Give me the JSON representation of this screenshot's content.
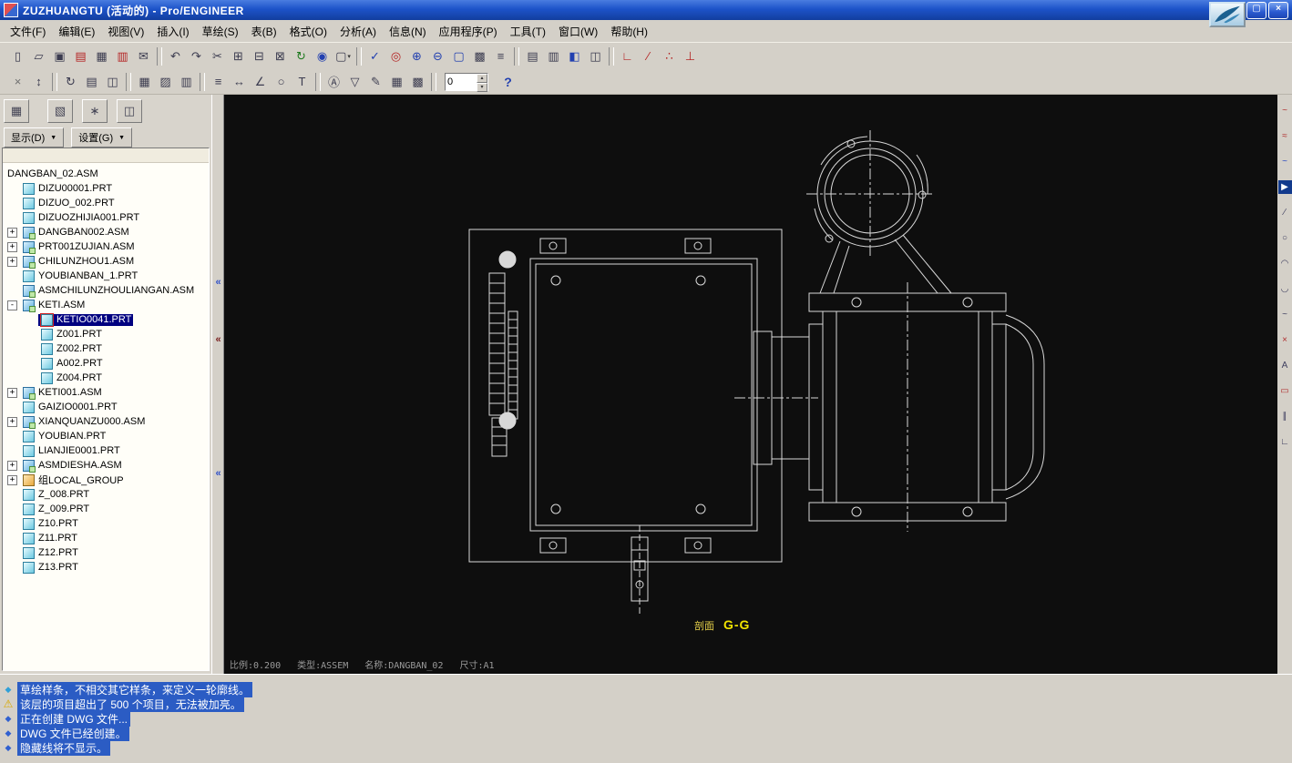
{
  "window": {
    "title": "ZUZHUANGTU (活动的) - Pro/ENGINEER",
    "buttons": [
      {
        "name": "minimize-button",
        "glyph": "_"
      },
      {
        "name": "maximize-button",
        "glyph": "▢"
      },
      {
        "name": "close-button",
        "glyph": "×"
      }
    ]
  },
  "menu": {
    "items": [
      {
        "label": "文件(F)"
      },
      {
        "label": "编辑(E)"
      },
      {
        "label": "视图(V)"
      },
      {
        "label": "插入(I)"
      },
      {
        "label": "草绘(S)"
      },
      {
        "label": "表(B)"
      },
      {
        "label": "格式(O)"
      },
      {
        "label": "分析(A)"
      },
      {
        "label": "信息(N)"
      },
      {
        "label": "应用程序(P)"
      },
      {
        "label": "工具(T)"
      },
      {
        "label": "窗口(W)"
      },
      {
        "label": "帮助(H)"
      }
    ]
  },
  "toolbar1": {
    "icons": [
      {
        "name": "new-file-button",
        "glyph": "▯",
        "cls": ""
      },
      {
        "name": "open-file-button",
        "glyph": "▱",
        "cls": ""
      },
      {
        "name": "save-file-button",
        "glyph": "▣",
        "cls": ""
      },
      {
        "name": "print-preview-button",
        "glyph": "▤",
        "cls": "red"
      },
      {
        "name": "print-button",
        "glyph": "▦",
        "cls": ""
      },
      {
        "name": "delete-old-versions-button",
        "glyph": "▥",
        "cls": "red"
      },
      {
        "name": "send-email-button",
        "glyph": "✉",
        "cls": ""
      },
      {
        "name": "separator",
        "glyph": "",
        "cls": "sep"
      },
      {
        "name": "undo-button",
        "glyph": "↶",
        "cls": ""
      },
      {
        "name": "redo-button",
        "glyph": "↷",
        "cls": ""
      },
      {
        "name": "cut-button",
        "glyph": "✂",
        "cls": ""
      },
      {
        "name": "copy-button",
        "glyph": "⊞",
        "cls": ""
      },
      {
        "name": "paste-button",
        "glyph": "⊟",
        "cls": ""
      },
      {
        "name": "paste-special-button",
        "glyph": "⊠",
        "cls": ""
      },
      {
        "name": "regenerate-button",
        "glyph": "↻",
        "cls": "green"
      },
      {
        "name": "find-button",
        "glyph": "◉",
        "cls": "blue"
      },
      {
        "name": "select-filter-button",
        "glyph": "▢",
        "cls": "dd"
      },
      {
        "name": "separator",
        "glyph": "",
        "cls": "sep"
      },
      {
        "name": "datum-display-button",
        "glyph": "✓",
        "cls": "blue"
      },
      {
        "name": "spin-center-button",
        "glyph": "◎",
        "cls": "red"
      },
      {
        "name": "zoom-in-button",
        "glyph": "⊕",
        "cls": "blue"
      },
      {
        "name": "zoom-out-button",
        "glyph": "⊖",
        "cls": "blue"
      },
      {
        "name": "refit-button",
        "glyph": "▢",
        "cls": "blue"
      },
      {
        "name": "repaint-button",
        "glyph": "▩",
        "cls": ""
      },
      {
        "name": "layers-button",
        "glyph": "≡",
        "cls": ""
      },
      {
        "name": "separator",
        "glyph": "",
        "cls": "sep"
      },
      {
        "name": "new-window-button",
        "glyph": "▤",
        "cls": ""
      },
      {
        "name": "close-window-button",
        "glyph": "▥",
        "cls": ""
      },
      {
        "name": "activate-window-button",
        "glyph": "◧",
        "cls": "blue"
      },
      {
        "name": "window-list-button",
        "glyph": "◫",
        "cls": ""
      },
      {
        "name": "separator",
        "glyph": "",
        "cls": "sep"
      },
      {
        "name": "sketch-corner-button",
        "glyph": "∟",
        "cls": "red"
      },
      {
        "name": "sketch-divide-button",
        "glyph": "∕",
        "cls": "red"
      },
      {
        "name": "sketch-points-button",
        "glyph": "∴",
        "cls": "red"
      },
      {
        "name": "sketch-coordsys-button",
        "glyph": "⊥",
        "cls": "red"
      }
    ]
  },
  "toolbar2": {
    "icons": [
      {
        "name": "close-x-button",
        "glyph": "×",
        "cls": "gray"
      },
      {
        "name": "lock-view-button",
        "glyph": "↕",
        "cls": ""
      },
      {
        "name": "separator",
        "glyph": "",
        "cls": "sep"
      },
      {
        "name": "update-sheets-button",
        "glyph": "↻",
        "cls": ""
      },
      {
        "name": "sheet-setup-button",
        "glyph": "▤",
        "cls": ""
      },
      {
        "name": "drawing-models-button",
        "glyph": "◫",
        "cls": ""
      },
      {
        "name": "separator",
        "glyph": "",
        "cls": "sep"
      },
      {
        "name": "table-create-button",
        "glyph": "▦",
        "cls": ""
      },
      {
        "name": "hatch-button",
        "glyph": "▨",
        "cls": ""
      },
      {
        "name": "column-layout-button",
        "glyph": "▥",
        "cls": ""
      },
      {
        "name": "separator",
        "glyph": "",
        "cls": "sep"
      },
      {
        "name": "dim-cleanup-button",
        "glyph": "≡",
        "cls": ""
      },
      {
        "name": "dim-move-button",
        "glyph": "↔",
        "cls": ""
      },
      {
        "name": "dim-slant-button",
        "glyph": "∠",
        "cls": ""
      },
      {
        "name": "balloon-note-button",
        "glyph": "○",
        "cls": ""
      },
      {
        "name": "text-style-button",
        "glyph": "T",
        "cls": ""
      },
      {
        "name": "separator",
        "glyph": "",
        "cls": "sep"
      },
      {
        "name": "datum-target-button",
        "glyph": "Ⓐ",
        "cls": ""
      },
      {
        "name": "surface-finish-button",
        "glyph": "▽",
        "cls": ""
      },
      {
        "name": "create-note-button",
        "glyph": "✎",
        "cls": ""
      },
      {
        "name": "insert-table-button",
        "glyph": "▦",
        "cls": ""
      },
      {
        "name": "repeat-region-button",
        "glyph": "▩",
        "cls": ""
      },
      {
        "name": "separator",
        "glyph": "",
        "cls": "sep"
      }
    ],
    "spinbox_value": "0",
    "spin_up_glyph": "▴",
    "spin_down_glyph": "▾",
    "help_glyph": "?"
  },
  "navigator": {
    "buttons": [
      {
        "name": "model-tree-tab-button",
        "glyph": "▦"
      },
      {
        "name": "folder-browser-tab-button",
        "glyph": "▧"
      },
      {
        "name": "favorites-tab-button",
        "glyph": "∗"
      },
      {
        "name": "tree-display-settings-button",
        "glyph": "◫"
      }
    ],
    "dropdowns": [
      {
        "name": "show-dropdown",
        "label": "显示(D)",
        "arrow": "▼"
      },
      {
        "name": "settings-dropdown",
        "label": "设置(G)",
        "arrow": "▼"
      }
    ]
  },
  "model_tree": {
    "items": [
      {
        "label": "DANGBAN_02.ASM",
        "cls": "l0 root",
        "expander": ""
      },
      {
        "label": "DIZU00001.PRT",
        "cls": "l1 part",
        "expander": ""
      },
      {
        "label": "DIZUO_002.PRT",
        "cls": "l1 part",
        "expander": ""
      },
      {
        "label": "DIZUOZHIJIA001.PRT",
        "cls": "l1 part",
        "expander": ""
      },
      {
        "label": "DANGBAN002.ASM",
        "cls": "l1 asm exp",
        "expander": "+"
      },
      {
        "label": "PRT001ZUJIAN.ASM",
        "cls": "l1 asm exp",
        "expander": "+"
      },
      {
        "label": "CHILUNZHOU1.ASM",
        "cls": "l1 asm exp",
        "expander": "+"
      },
      {
        "label": "YOUBIANBAN_1.PRT",
        "cls": "l1 part",
        "expander": ""
      },
      {
        "label": "ASMCHILUNZHOULIANGAN.ASM",
        "cls": "l1 asm",
        "expander": ""
      },
      {
        "label": "KETI.ASM",
        "cls": "l1 asm exp",
        "expander": "-"
      },
      {
        "label": "KETIO0041.PRT",
        "cls": "l2 part sel",
        "expander": ""
      },
      {
        "label": "Z001.PRT",
        "cls": "l2 part",
        "expander": ""
      },
      {
        "label": "Z002.PRT",
        "cls": "l2 part",
        "expander": ""
      },
      {
        "label": "A002.PRT",
        "cls": "l2 part",
        "expander": ""
      },
      {
        "label": "Z004.PRT",
        "cls": "l2 part",
        "expander": ""
      },
      {
        "label": "KETI001.ASM",
        "cls": "l1 asm exp",
        "expander": "+"
      },
      {
        "label": "GAIZIO0001.PRT",
        "cls": "l1 part",
        "expander": ""
      },
      {
        "label": "XIANQUANZU000.ASM",
        "cls": "l1 asm exp",
        "expander": "+"
      },
      {
        "label": "YOUBIAN.PRT",
        "cls": "l1 part",
        "expander": ""
      },
      {
        "label": "LIANJIE0001.PRT",
        "cls": "l1 part",
        "expander": ""
      },
      {
        "label": "ASMDIESHA.ASM",
        "cls": "l1 asm exp",
        "expander": "+"
      },
      {
        "label": "组LOCAL_GROUP",
        "cls": "l1 group exp",
        "expander": "+"
      },
      {
        "label": "Z_008.PRT",
        "cls": "l1 part",
        "expander": ""
      },
      {
        "label": "Z_009.PRT",
        "cls": "l1 part",
        "expander": ""
      },
      {
        "label": "Z10.PRT",
        "cls": "l1 part",
        "expander": ""
      },
      {
        "label": "Z11.PRT",
        "cls": "l1 part",
        "expander": ""
      },
      {
        "label": "Z12.PRT",
        "cls": "l1 part",
        "expander": ""
      },
      {
        "label": "Z13.PRT",
        "cls": "l1 part",
        "expander": ""
      }
    ]
  },
  "sash": {
    "chevrons": [
      {
        "name": "collapse-chevron-icon",
        "glyph": "«",
        "cls": "c1"
      },
      {
        "name": "collapse-chevron-icon",
        "glyph": "«",
        "cls": "c2"
      },
      {
        "name": "collapse-chevron-icon",
        "glyph": "«",
        "cls": "c3"
      }
    ]
  },
  "drawing": {
    "section_label": {
      "prefix": "剖面",
      "text": "G-G"
    },
    "status": {
      "scale": "比例:0.200",
      "type": "类型:ASSEM",
      "name": "名称:DANGBAN_02",
      "size": "尺寸:A1"
    }
  },
  "right_toolbar": {
    "icons": [
      {
        "name": "spline-points-tool-button",
        "glyph": "~",
        "cls": "red"
      },
      {
        "name": "spline-curve-tool-button",
        "glyph": "≈",
        "cls": "red"
      },
      {
        "name": "spline-surface-tool-button",
        "glyph": "~",
        "cls": "blue"
      },
      {
        "name": "select-tool-button",
        "glyph": "▶",
        "cls": "active"
      },
      {
        "name": "line-tool-button",
        "glyph": "∕",
        "cls": ""
      },
      {
        "name": "circle-tool-button",
        "glyph": "○",
        "cls": ""
      },
      {
        "name": "arc-tool-button",
        "glyph": "◠",
        "cls": ""
      },
      {
        "name": "fillet-tool-button",
        "glyph": "◡",
        "cls": ""
      },
      {
        "name": "spline-tool-button",
        "glyph": "~",
        "cls": ""
      },
      {
        "name": "point-tool-button",
        "glyph": "×",
        "cls": "red"
      },
      {
        "name": "text-tool-button",
        "glyph": "A",
        "cls": ""
      },
      {
        "name": "rectangle-tool-button",
        "glyph": "▭",
        "cls": "red"
      },
      {
        "name": "offset-edge-tool-button",
        "glyph": "∥",
        "cls": ""
      },
      {
        "name": "chamfer-tool-button",
        "glyph": "∟",
        "cls": ""
      }
    ]
  },
  "messages": {
    "lines": [
      {
        "name": "message-line",
        "cls": "prompt",
        "icon_glyph": "◆",
        "text": "草绘样条，不相交其它样条，来定义一轮廓线。"
      },
      {
        "name": "message-line",
        "cls": "warn",
        "icon_glyph": "⚠",
        "text": "该层的项目超出了 500 个项目，无法被加亮。"
      },
      {
        "name": "message-line",
        "cls": "info",
        "icon_glyph": "◆",
        "text": "正在创建 DWG 文件..."
      },
      {
        "name": "message-line",
        "cls": "info",
        "icon_glyph": "◆",
        "text": "DWG 文件已经创建。"
      },
      {
        "name": "message-line",
        "cls": "info",
        "icon_glyph": "◆",
        "text": "隐藏线将不显示。"
      }
    ]
  },
  "colors": {
    "titlebar": "#1d53c9",
    "selection": "#000080",
    "message_highlight": "#2b5cc4",
    "drawing_background": "#0e0e0e",
    "section_label": "#f2e400",
    "cad_line": "#d8d8d8"
  }
}
